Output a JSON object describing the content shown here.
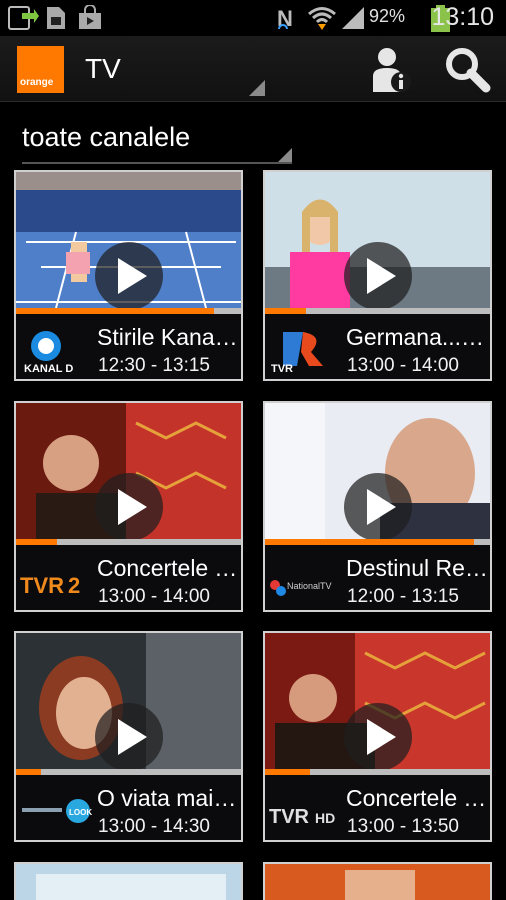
{
  "status_bar": {
    "battery_percent": "92%",
    "time": "13:10",
    "icons": [
      "sd-card-icon",
      "download-icon",
      "storage-icon",
      "shopping-bag-icon",
      "nfc-icon",
      "wifi-icon",
      "signal-icon",
      "battery-icon"
    ]
  },
  "action_bar": {
    "logo_text": "orange",
    "title": "TV",
    "icons": [
      "profile-info-icon",
      "search-icon"
    ]
  },
  "filter": {
    "label": "toate canalele"
  },
  "programs": [
    {
      "channel": "KANAL D",
      "title": "Stirile Kanal D",
      "time": "12:30 - 13:15",
      "progress": 0.88
    },
    {
      "channel": "TVR",
      "title": "Germana...LIVE",
      "time": "13:00 - 14:00",
      "progress": 0.18
    },
    {
      "channel": "TVR 2",
      "title": "Concertele Toamnei",
      "time": "13:00 - 14:00",
      "progress": 0.18
    },
    {
      "channel": "National TV",
      "title": "Destinul Regelui",
      "time": "12:00 - 13:15",
      "progress": 0.93
    },
    {
      "channel": "LOOK",
      "title": "O viata mai buna",
      "time": "13:00 - 14:30",
      "progress": 0.11
    },
    {
      "channel": "TVR HD",
      "title": "Concertele Toamnei",
      "time": "13:00 - 13:50",
      "progress": 0.2
    }
  ],
  "colors": {
    "accent": "#ff7900",
    "background": "#000000",
    "card_border": "#d0d0d0"
  }
}
